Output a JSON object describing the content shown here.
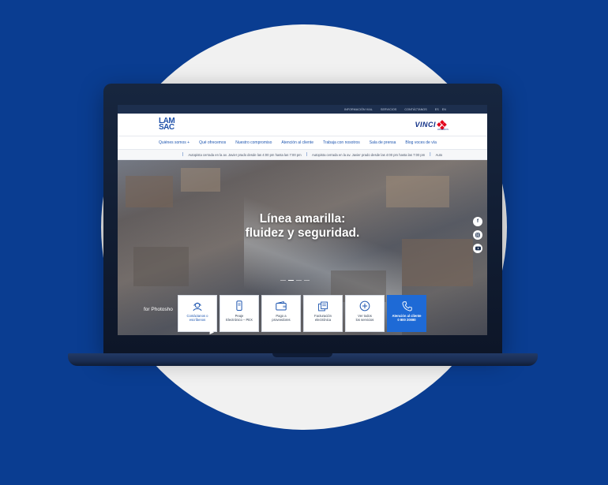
{
  "colors": {
    "background": "#0a3d91",
    "brand_blue": "#1e56b0",
    "cta_blue": "#1e6ad6",
    "vinci_red": "#e3001b"
  },
  "utility_bar": {
    "links": [
      "INFORMACIÓN VIAL",
      "SERVICIOS",
      "CONTÁCTANOS"
    ],
    "lang": [
      "ES",
      "EN"
    ]
  },
  "header": {
    "logo_line1": "LAM",
    "logo_line2": "SAC",
    "partner_logo": "VINCI",
    "partner_sub": "HIGHWAYS"
  },
  "nav": {
    "items": [
      "Quiénes somos  +",
      "Qué ofrecemos",
      "Nuestro compromiso",
      "Atención al cliente",
      "Trabaja con nosotros",
      "Sala de prensa",
      "Blog voces de vía"
    ]
  },
  "ticker": {
    "items": [
      "Autopista cerrada en la av. Javier prado desde las 4:00 pm hasta las 7:00 pm",
      "Autopista cerrada en la av. Javier prado desde las 4:00 pm hasta las 7:00 pm",
      "Auto"
    ]
  },
  "hero": {
    "title_line1": "Línea amarilla:",
    "title_line2": "fluidez y seguridad.",
    "overlay_text": "for Photosho"
  },
  "social": {
    "icons": [
      "facebook-icon",
      "instagram-icon",
      "youtube-icon"
    ]
  },
  "services": [
    {
      "label": "Contáctanos o\nescríbenos",
      "icon": "headset-icon"
    },
    {
      "label": "Peaje\nElectrónico – PEX",
      "icon": "phone-icon"
    },
    {
      "label": "Pago a\nproveedores",
      "icon": "wallet-icon"
    },
    {
      "label": "Facturación\nelectrónica",
      "icon": "invoice-icon"
    },
    {
      "label": "Ver todos\nlos servicios",
      "icon": "plus-circle-icon"
    },
    {
      "label": "Atención al cliente\n0 800 20080",
      "icon": "phone-call-icon"
    }
  ]
}
